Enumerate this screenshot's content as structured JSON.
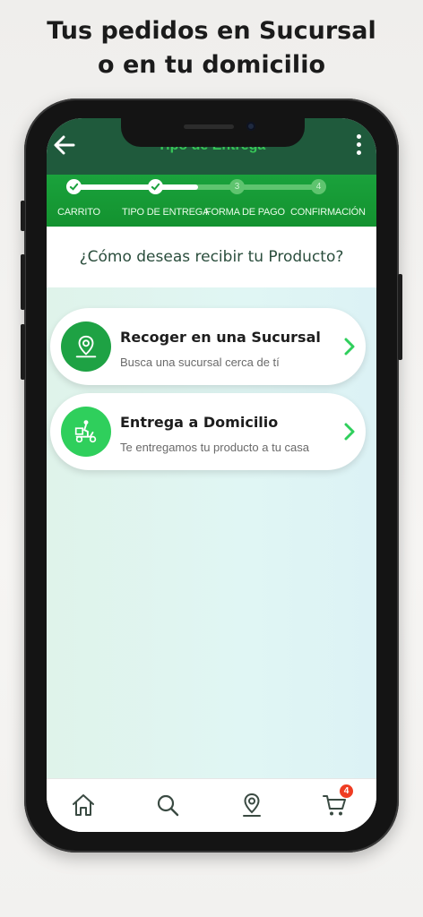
{
  "headline": {
    "line1": "Tus pedidos en Sucursal",
    "line2": "o en tu domicilio"
  },
  "app_bar": {
    "title": "Tipo de Entrega",
    "back_icon": "arrow-left-icon",
    "menu_icon": "kebab-menu-icon"
  },
  "stepper": {
    "steps": [
      {
        "label": "CARRITO",
        "number": "1",
        "status": "done"
      },
      {
        "label": "TIPO DE ENTREGA",
        "number": "2",
        "status": "done"
      },
      {
        "label": "FORMA DE PAGO",
        "number": "3",
        "status": "pending"
      },
      {
        "label": "CONFIRMACIÓN",
        "number": "4",
        "status": "pending"
      }
    ],
    "progress_fraction": 0.5
  },
  "question": "¿Cómo deseas recibir tu Producto?",
  "options": [
    {
      "title": "Recoger en una Sucursal",
      "subtitle": "Busca una sucursal cerca de tí",
      "icon": "map-pin-icon"
    },
    {
      "title": "Entrega a Domicilio",
      "subtitle": "Te entregamos tu producto a tu casa",
      "icon": "delivery-scooter-icon"
    }
  ],
  "bottom_nav": {
    "items": [
      {
        "name": "home",
        "icon": "home-icon"
      },
      {
        "name": "search",
        "icon": "search-icon"
      },
      {
        "name": "locations",
        "icon": "map-pin-icon"
      },
      {
        "name": "cart",
        "icon": "cart-icon"
      }
    ],
    "cart_badge": "4"
  },
  "colors": {
    "brand_dark": "#1f5a3c",
    "brand_green": "#1aa23c",
    "accent_green": "#2fcf5c",
    "badge_red": "#ef3c22"
  }
}
